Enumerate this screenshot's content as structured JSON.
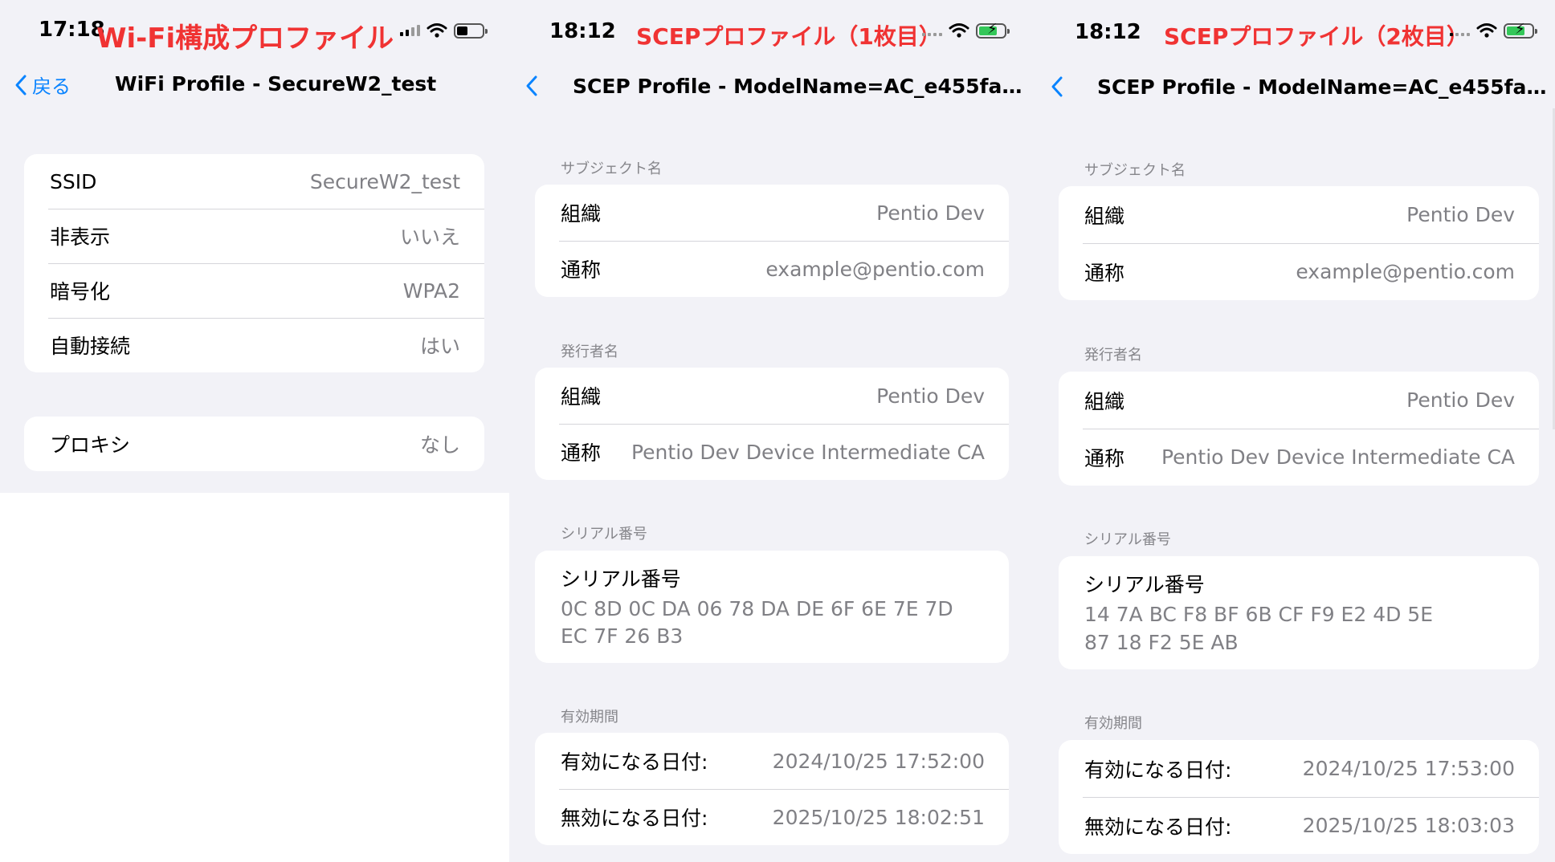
{
  "panels": [
    {
      "status": {
        "time": "17:18",
        "caption": "Wi-Fi構成プロファイル"
      },
      "nav": {
        "back_label": "戻る",
        "title": "WiFi Profile - SecureW2_test"
      },
      "groups": [
        {
          "rows": [
            {
              "label": "SSID",
              "value": "SecureW2_test"
            },
            {
              "label": "非表示",
              "value": "いいえ"
            },
            {
              "label": "暗号化",
              "value": "WPA2"
            },
            {
              "label": "自動接続",
              "value": "はい"
            }
          ]
        },
        {
          "rows": [
            {
              "label": "プロキシ",
              "value": "なし"
            }
          ]
        }
      ]
    },
    {
      "status": {
        "time": "18:12",
        "caption": "SCEPプロファイル（1枚目）"
      },
      "nav": {
        "title": "SCEP Profile - ModelName=AC_e455fae..."
      },
      "sections": [
        {
          "header": "サブジェクト名",
          "rows": [
            {
              "label": "組織",
              "value": "Pentio Dev"
            },
            {
              "label": "通称",
              "value": "example@pentio.com"
            }
          ]
        },
        {
          "header": "発行者名",
          "rows": [
            {
              "label": "組織",
              "value": "Pentio Dev"
            },
            {
              "label": "通称",
              "value": "Pentio Dev Device Intermediate CA"
            }
          ]
        },
        {
          "header": "シリアル番号",
          "rows": [
            {
              "label": "シリアル番号",
              "value": "0C 8D 0C DA 06 78 DA DE 6F 6E 7E 7D EC 7F 26 B3"
            }
          ]
        },
        {
          "header": "有効期間",
          "rows": [
            {
              "label": "有効になる日付:",
              "value": "2024/10/25 17:52:00"
            },
            {
              "label": "無効になる日付:",
              "value": "2025/10/25 18:02:51"
            }
          ]
        }
      ]
    },
    {
      "status": {
        "time": "18:12",
        "caption": "SCEPプロファイル（2枚目）"
      },
      "nav": {
        "title": "SCEP Profile - ModelName=AC_e455fae..."
      },
      "sections": [
        {
          "header": "サブジェクト名",
          "rows": [
            {
              "label": "組織",
              "value": "Pentio Dev"
            },
            {
              "label": "通称",
              "value": "example@pentio.com"
            }
          ]
        },
        {
          "header": "発行者名",
          "rows": [
            {
              "label": "組織",
              "value": "Pentio Dev"
            },
            {
              "label": "通称",
              "value": "Pentio Dev Device Intermediate CA"
            }
          ]
        },
        {
          "header": "シリアル番号",
          "rows": [
            {
              "label": "シリアル番号",
              "value": "14 7A BC F8 BF 6B CF F9 E2 4D 5E 87 18 F2 5E AB"
            }
          ]
        },
        {
          "header": "有効期間",
          "rows": [
            {
              "label": "有効になる日付:",
              "value": "2024/10/25 17:53:00"
            },
            {
              "label": "無効になる日付:",
              "value": "2025/10/25 18:03:03"
            }
          ]
        }
      ]
    }
  ],
  "colors": {
    "accent": "#0a84ff",
    "caption": "#f03333",
    "background": "#f2f2f7",
    "secondary_text": "#808085"
  }
}
